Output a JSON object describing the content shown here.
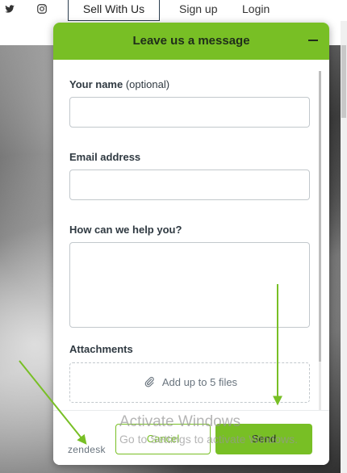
{
  "nav": {
    "social": [
      "twitter-icon",
      "instagram-icon"
    ],
    "sell_label": "Sell With Us",
    "signup_label": "Sign up",
    "login_label": "Login"
  },
  "widget": {
    "title": "Leave us a message",
    "name_label": "Your name",
    "name_optional": "(optional)",
    "email_label": "Email address",
    "help_label": "How can we help you?",
    "attachments_label": "Attachments",
    "attachments_hint": "Add up to 5 files",
    "brand": "zendesk",
    "cancel_label": "Cancel",
    "send_label": "Send"
  },
  "watermark": {
    "line1": "Activate Windows",
    "line2": "Go to Settings to activate Windows."
  },
  "colors": {
    "accent": "#78bf25",
    "annotation_arrow": "#78bf25"
  }
}
